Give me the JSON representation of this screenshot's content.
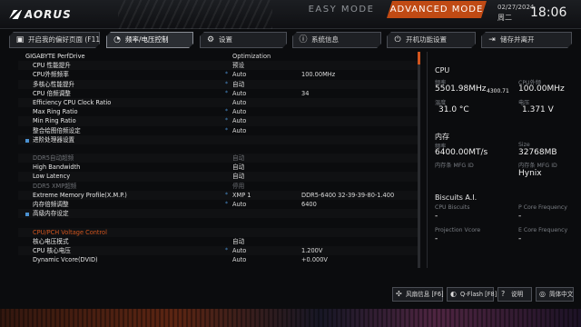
{
  "brand": {
    "name": "AORUS"
  },
  "modes": {
    "easy": "EASY MODE",
    "advanced": "ADVANCED MODE"
  },
  "datetime": {
    "date": "02/27/2024",
    "weekday": "周二",
    "time": "18:06"
  },
  "tabs": [
    {
      "label": "开启我的偏好页面 (F11)",
      "icon": "bookmark-icon"
    },
    {
      "label": "频率/电压控制",
      "icon": "gauge-icon"
    },
    {
      "label": "设置",
      "icon": "gear-icon"
    },
    {
      "label": "系统信息",
      "icon": "info-icon"
    },
    {
      "label": "开机功能设置",
      "icon": "power-icon"
    },
    {
      "label": "储存并离开",
      "icon": "exit-icon"
    }
  ],
  "rows": [
    {
      "label": "GIGABYTE PerfDrive",
      "star": "",
      "value": "Optimization",
      "current": "",
      "kind": "sub"
    },
    {
      "label": "CPU 性能提升",
      "star": "",
      "value": "预设",
      "current": ""
    },
    {
      "label": "CPU外频频率",
      "star": "*",
      "value": "Auto",
      "current": "100.00MHz"
    },
    {
      "label": "多核心性能提升",
      "star": "*",
      "value": "自动",
      "current": ""
    },
    {
      "label": "CPU 倍频调整",
      "star": "*",
      "value": "Auto",
      "current": "34"
    },
    {
      "label": "Efficiency CPU Clock Ratio",
      "star": "",
      "value": "Auto",
      "current": ""
    },
    {
      "label": "Max Ring Ratio",
      "star": "*",
      "value": "Auto",
      "current": ""
    },
    {
      "label": "Min Ring Ratio",
      "star": "*",
      "value": "Auto",
      "current": ""
    },
    {
      "label": "整合绘图倍频设定",
      "star": "*",
      "value": "Auto",
      "current": ""
    },
    {
      "label": "进阶处理器设置",
      "star": "",
      "value": "",
      "current": "",
      "kind": "bullet"
    },
    {
      "label": "",
      "star": "",
      "value": "",
      "current": "",
      "kind": "blank"
    },
    {
      "label": "DDR5自动超频",
      "star": "",
      "value": "自动",
      "current": "",
      "kind": "grey"
    },
    {
      "label": "High Bandwidth",
      "star": "",
      "value": "自动",
      "current": ""
    },
    {
      "label": "Low Latency",
      "star": "",
      "value": "自动",
      "current": ""
    },
    {
      "label": "DDR5 XMP超频",
      "star": "",
      "value": "停用",
      "current": "",
      "kind": "grey"
    },
    {
      "label": "Extreme Memory Profile(X.M.P.)",
      "star": "*",
      "value": "XMP 1",
      "current": "DDR5-6400 32-39-39-80-1.400"
    },
    {
      "label": "内存倍频调整",
      "star": "*",
      "value": "Auto",
      "current": "6400"
    },
    {
      "label": "高级内存设定",
      "star": "",
      "value": "",
      "current": "",
      "kind": "bullet"
    },
    {
      "label": "",
      "star": "",
      "value": "",
      "current": "",
      "kind": "blank"
    },
    {
      "label": "CPU/PCH Voltage Control",
      "star": "",
      "value": "",
      "current": "",
      "kind": "hdr"
    },
    {
      "label": "核心电压模式",
      "star": "",
      "value": "自动",
      "current": ""
    },
    {
      "label": "CPU 核心电压",
      "star": "*",
      "value": "Auto",
      "current": "1.200V"
    },
    {
      "label": "Dynamic Vcore(DVID)",
      "star": "",
      "value": "Auto",
      "current": "+0.000V"
    }
  ],
  "side": {
    "cpu": {
      "title": "CPU",
      "freq_label": "频率",
      "freq": "5501.98MHz",
      "freq_sub": "4300.71",
      "bclk_label": "CPU外频",
      "bclk": "100.00MHz",
      "temp_label": "温度",
      "temp": "31.0 °C",
      "volt_label": "电压",
      "volt": "1.371 V"
    },
    "mem": {
      "title": "内存",
      "freq_label": "频率",
      "freq": "6400.00MT/s",
      "size_label": "Size",
      "size": "32768MB",
      "mfg_label": "内存条 MFG ID",
      "mfg": "",
      "mfg2_label": "内存条 MFG ID",
      "mfg2": "Hynix"
    },
    "biscuits": {
      "title": "Biscuits A.I.",
      "cpu_label": "CPU Biscuits",
      "cpu": "-",
      "pcore_label": "P Core Frequency",
      "pcore": "-",
      "proj_label": "Projection Vcore",
      "proj": "-",
      "ecore_label": "E Core Frequency",
      "ecore": "-"
    }
  },
  "bottom": {
    "fan": "风扇信息 [F6]",
    "qflash": "Q-Flash [F8]",
    "help": "说明",
    "lang": "简体中文"
  },
  "colors": {
    "accent": "#c04a14",
    "highlight": "#4a90d0"
  }
}
